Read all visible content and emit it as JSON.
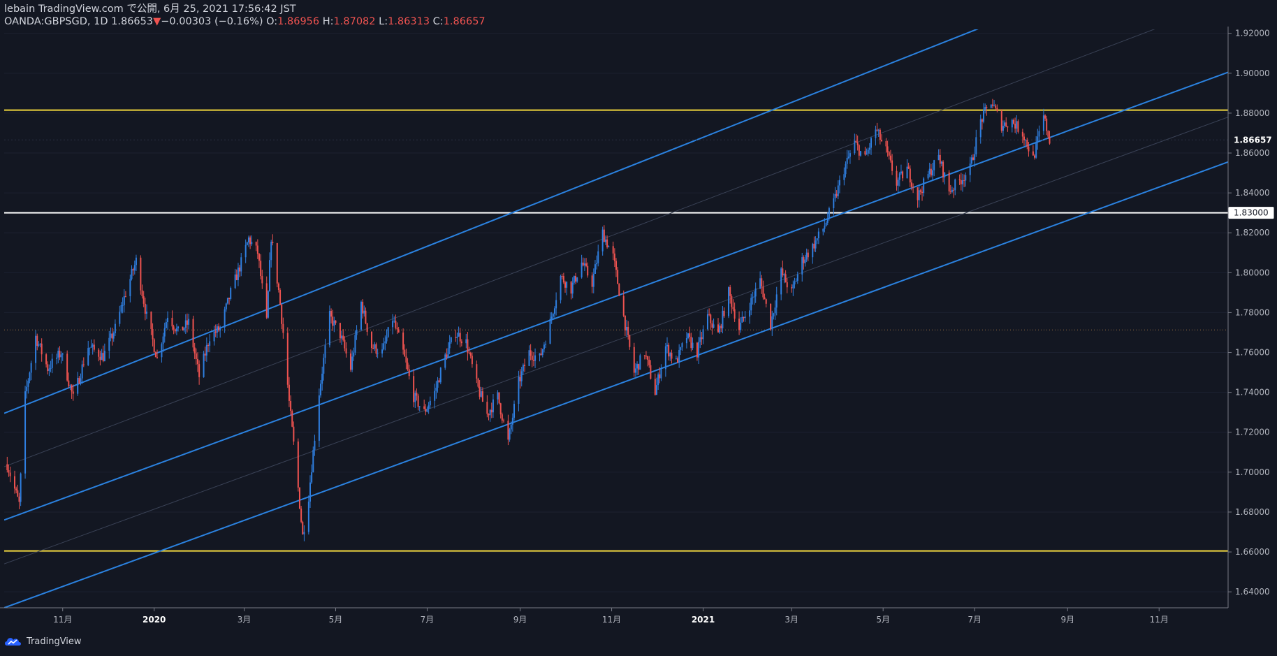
{
  "header": {
    "publish_line": "lebain TradingView.com で公開, 6月 25, 2021 17:56:42 JST",
    "symbol": "OANDA:GBPSGD, 1D",
    "last": "1.86653",
    "change": "−0.00303 (−0.16%)",
    "o_label": "O:",
    "o_value": "1.86956",
    "h_label": "H:",
    "h_value": "1.87082",
    "l_label": "L:",
    "l_value": "1.86313",
    "c_label": "C:",
    "c_value": "1.86657"
  },
  "footer": {
    "brand": "TradingView"
  },
  "colors": {
    "background": "#131722",
    "up": "#2f7fe0",
    "down": "#ef5350",
    "channel": "#2b82e0",
    "yellow_line": "#f0d63c",
    "white_line": "#ffffff",
    "axis_text": "#b2b5be",
    "axis_line": "#787b86"
  },
  "chart_data": {
    "type": "candlestick",
    "title": "OANDA:GBPSGD, 1D",
    "x_ticks": [
      "11月",
      "2020",
      "3月",
      "5月",
      "7月",
      "9月",
      "11月",
      "2021",
      "3月",
      "5月",
      "7月",
      "9月",
      "11月"
    ],
    "bold_x_ticks": [
      "2020",
      "2021"
    ],
    "y_ticks": [
      "1.64000",
      "1.66000",
      "1.68000",
      "1.70000",
      "1.72000",
      "1.74000",
      "1.76000",
      "1.78000",
      "1.80000",
      "1.82000",
      "1.84000",
      "1.86000",
      "1.88000",
      "1.90000",
      "1.92000"
    ],
    "ylim": [
      1.632,
      1.922
    ],
    "x_range": [
      "2019-09-23",
      "2021-12-17"
    ],
    "price_labels": [
      {
        "text": "1.86657",
        "value": 1.86657,
        "style": "last"
      },
      {
        "text": "1.83000",
        "value": 1.83,
        "style": "level"
      }
    ],
    "horizontal_lines": [
      {
        "value": 1.8815,
        "color": "yellow"
      },
      {
        "value": 1.83,
        "color": "white"
      },
      {
        "value": 1.6605,
        "color": "yellow"
      },
      {
        "value": 1.7713,
        "color": "dotted"
      }
    ],
    "channel_lines": [
      {
        "role": "upper",
        "from": [
          "2019-09-23",
          1.7295
        ],
        "to": [
          "2021-07-31",
          1.9305
        ]
      },
      {
        "role": "middle",
        "from": [
          "2019-09-23",
          1.676
        ],
        "to": [
          "2021-12-17",
          1.9005
        ]
      },
      {
        "role": "lower",
        "from": [
          "2019-09-23",
          1.632
        ],
        "to": [
          "2021-12-17",
          1.8555
        ]
      }
    ],
    "close_path": [
      [
        "2019-09-25",
        1.704
      ],
      [
        "2019-10-03",
        1.684
      ],
      [
        "2019-10-07",
        1.738
      ],
      [
        "2019-10-14",
        1.768
      ],
      [
        "2019-10-22",
        1.752
      ],
      [
        "2019-10-31",
        1.76
      ],
      [
        "2019-11-08",
        1.737
      ],
      [
        "2019-11-18",
        1.763
      ],
      [
        "2019-11-28",
        1.758
      ],
      [
        "2019-12-06",
        1.772
      ],
      [
        "2019-12-13",
        1.79
      ],
      [
        "2019-12-20",
        1.806
      ],
      [
        "2019-12-27",
        1.778
      ],
      [
        "2020-01-03",
        1.757
      ],
      [
        "2020-01-10",
        1.779
      ],
      [
        "2020-01-17",
        1.77
      ],
      [
        "2020-01-24",
        1.775
      ],
      [
        "2020-01-31",
        1.748
      ],
      [
        "2020-02-07",
        1.768
      ],
      [
        "2020-02-14",
        1.772
      ],
      [
        "2020-02-21",
        1.79
      ],
      [
        "2020-02-28",
        1.805
      ],
      [
        "2020-03-04",
        1.817
      ],
      [
        "2020-03-10",
        1.81
      ],
      [
        "2020-03-16",
        1.775
      ],
      [
        "2020-03-19",
        1.818
      ],
      [
        "2020-03-24",
        1.791
      ],
      [
        "2020-03-27",
        1.77
      ],
      [
        "2020-03-31",
        1.735
      ],
      [
        "2020-04-05",
        1.7
      ],
      [
        "2020-04-09",
        1.668
      ],
      [
        "2020-04-13",
        1.688
      ],
      [
        "2020-04-20",
        1.74
      ],
      [
        "2020-04-27",
        1.778
      ],
      [
        "2020-05-04",
        1.769
      ],
      [
        "2020-05-11",
        1.752
      ],
      [
        "2020-05-18",
        1.785
      ],
      [
        "2020-05-25",
        1.763
      ],
      [
        "2020-06-01",
        1.76
      ],
      [
        "2020-06-08",
        1.777
      ],
      [
        "2020-06-15",
        1.76
      ],
      [
        "2020-06-22",
        1.738
      ],
      [
        "2020-06-29",
        1.73
      ],
      [
        "2020-07-06",
        1.74
      ],
      [
        "2020-07-13",
        1.758
      ],
      [
        "2020-07-20",
        1.77
      ],
      [
        "2020-07-27",
        1.765
      ],
      [
        "2020-08-03",
        1.744
      ],
      [
        "2020-08-10",
        1.729
      ],
      [
        "2020-08-17",
        1.738
      ],
      [
        "2020-08-24",
        1.715
      ],
      [
        "2020-08-31",
        1.745
      ],
      [
        "2020-09-07",
        1.76
      ],
      [
        "2020-09-14",
        1.757
      ],
      [
        "2020-09-21",
        1.775
      ],
      [
        "2020-09-28",
        1.798
      ],
      [
        "2020-10-05",
        1.792
      ],
      [
        "2020-10-12",
        1.805
      ],
      [
        "2020-10-19",
        1.795
      ],
      [
        "2020-10-26",
        1.82
      ],
      [
        "2020-11-02",
        1.808
      ],
      [
        "2020-11-09",
        1.778
      ],
      [
        "2020-11-16",
        1.75
      ],
      [
        "2020-11-23",
        1.76
      ],
      [
        "2020-11-30",
        1.74
      ],
      [
        "2020-12-07",
        1.763
      ],
      [
        "2020-12-14",
        1.755
      ],
      [
        "2020-12-21",
        1.768
      ],
      [
        "2020-12-28",
        1.76
      ],
      [
        "2021-01-04",
        1.778
      ],
      [
        "2021-01-11",
        1.769
      ],
      [
        "2021-01-18",
        1.79
      ],
      [
        "2021-01-25",
        1.772
      ],
      [
        "2021-02-01",
        1.784
      ],
      [
        "2021-02-08",
        1.796
      ],
      [
        "2021-02-15",
        1.774
      ],
      [
        "2021-02-22",
        1.8
      ],
      [
        "2021-03-01",
        1.79
      ],
      [
        "2021-03-08",
        1.806
      ],
      [
        "2021-03-15",
        1.813
      ],
      [
        "2021-03-22",
        1.822
      ],
      [
        "2021-03-29",
        1.835
      ],
      [
        "2021-04-05",
        1.852
      ],
      [
        "2021-04-12",
        1.865
      ],
      [
        "2021-04-19",
        1.857
      ],
      [
        "2021-04-26",
        1.872
      ],
      [
        "2021-05-03",
        1.861
      ],
      [
        "2021-05-10",
        1.845
      ],
      [
        "2021-05-17",
        1.852
      ],
      [
        "2021-05-24",
        1.838
      ],
      [
        "2021-05-31",
        1.849
      ],
      [
        "2021-06-07",
        1.858
      ],
      [
        "2021-06-14",
        1.841
      ],
      [
        "2021-06-21",
        1.846
      ],
      [
        "2021-06-28",
        1.852
      ],
      [
        "2021-07-05",
        1.876
      ],
      [
        "2021-07-12",
        1.886
      ],
      [
        "2021-07-19",
        1.874
      ],
      [
        "2021-07-26",
        1.876
      ],
      [
        "2021-08-02",
        1.87
      ],
      [
        "2021-08-09",
        1.857
      ],
      [
        "2021-08-16",
        1.878
      ],
      [
        "2021-08-20",
        1.8666
      ]
    ]
  }
}
